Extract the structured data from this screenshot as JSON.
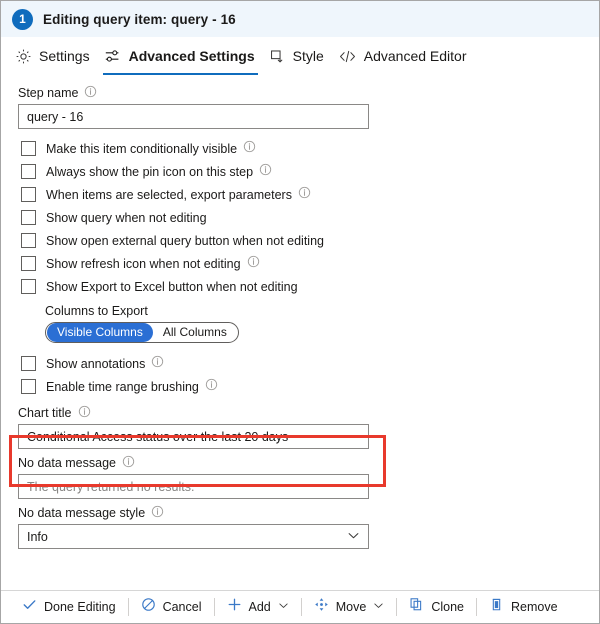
{
  "header": {
    "badge": "1",
    "title": "Editing query item: query - 16"
  },
  "tabs": [
    {
      "label": "Settings",
      "icon": "gear-icon",
      "active": false
    },
    {
      "label": "Advanced Settings",
      "icon": "sliders-icon",
      "active": true
    },
    {
      "label": "Style",
      "icon": "style-square-icon",
      "active": false
    },
    {
      "label": "Advanced Editor",
      "icon": "code-brackets-icon",
      "active": false
    }
  ],
  "form": {
    "step_name": {
      "label": "Step name",
      "value": "query - 16"
    },
    "checkboxes": [
      {
        "label": "Make this item conditionally visible",
        "checked": false,
        "info": true
      },
      {
        "label": "Always show the pin icon on this step",
        "checked": false,
        "info": true
      },
      {
        "label": "When items are selected, export parameters",
        "checked": false,
        "info": true
      },
      {
        "label": "Show query when not editing",
        "checked": false,
        "info": false
      },
      {
        "label": "Show open external query button when not editing",
        "checked": false,
        "info": false
      },
      {
        "label": "Show refresh icon when not editing",
        "checked": false,
        "info": true
      },
      {
        "label": "Show Export to Excel button when not editing",
        "checked": false,
        "info": false
      }
    ],
    "columns_to_export": {
      "label": "Columns to Export",
      "options": [
        "Visible Columns",
        "All Columns"
      ],
      "selected": "Visible Columns"
    },
    "checkboxes2": [
      {
        "label": "Show annotations",
        "checked": false,
        "info": true
      },
      {
        "label": "Enable time range brushing",
        "checked": false,
        "info": true
      }
    ],
    "chart_title": {
      "label": "Chart title",
      "value": "Conditional Access status over the last 20 days"
    },
    "no_data_message": {
      "label": "No data message",
      "placeholder": "The query returned no results."
    },
    "no_data_message_style": {
      "label": "No data message style",
      "value": "Info"
    }
  },
  "toolbar": [
    {
      "label": "Done Editing",
      "icon": "checkmark-icon",
      "caret": false
    },
    {
      "label": "Cancel",
      "icon": "block-icon",
      "caret": false
    },
    {
      "label": "Add",
      "icon": "plus-icon",
      "caret": true
    },
    {
      "label": "Move",
      "icon": "move-arrows-icon",
      "caret": true
    },
    {
      "label": "Clone",
      "icon": "copy-icon",
      "caret": false
    },
    {
      "label": "Remove",
      "icon": "trash-icon",
      "caret": false
    }
  ],
  "colors": {
    "accent": "#0f6cbd",
    "header_band": "#eff6fc",
    "pill_selected": "#2b6fd4",
    "annotation": "#e8392c",
    "toolbar_icon": "#3b79c7"
  },
  "annotations": [
    {
      "name": "chart-title-highlight"
    },
    {
      "name": "done-editing-highlight"
    }
  ]
}
